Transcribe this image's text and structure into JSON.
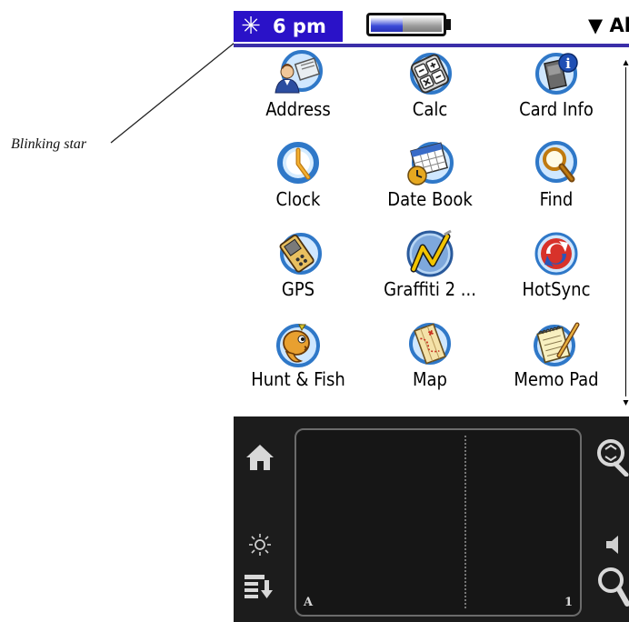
{
  "annotation": {
    "text": "Blinking star"
  },
  "status_bar": {
    "star_icon": "asterisk-icon",
    "time": "6 pm",
    "battery_level": 0.45,
    "category_label": "▼ All"
  },
  "launcher": {
    "apps": [
      {
        "label": "Address",
        "icon": "address-book-icon"
      },
      {
        "label": "Calc",
        "icon": "calculator-icon"
      },
      {
        "label": "Card Info",
        "icon": "sd-card-icon"
      },
      {
        "label": "Clock",
        "icon": "clock-icon"
      },
      {
        "label": "Date Book",
        "icon": "calendar-icon"
      },
      {
        "label": "Find",
        "icon": "magnifier-icon"
      },
      {
        "label": "GPS",
        "icon": "gps-icon"
      },
      {
        "label": "Graffiti 2 ...",
        "icon": "graffiti-icon"
      },
      {
        "label": "HotSync",
        "icon": "hotsync-icon"
      },
      {
        "label": "Hunt & Fish",
        "icon": "fish-icon"
      },
      {
        "label": "Map",
        "icon": "map-icon"
      },
      {
        "label": "Memo Pad",
        "icon": "memo-pad-icon"
      }
    ]
  },
  "graffiti": {
    "left_corner_label": "A",
    "right_corner_label": "1",
    "silk_icons": [
      "home-icon",
      "brightness-icon",
      "menu-icon",
      "find-replace-icon",
      "speaker-icon",
      "search-icon"
    ]
  }
}
